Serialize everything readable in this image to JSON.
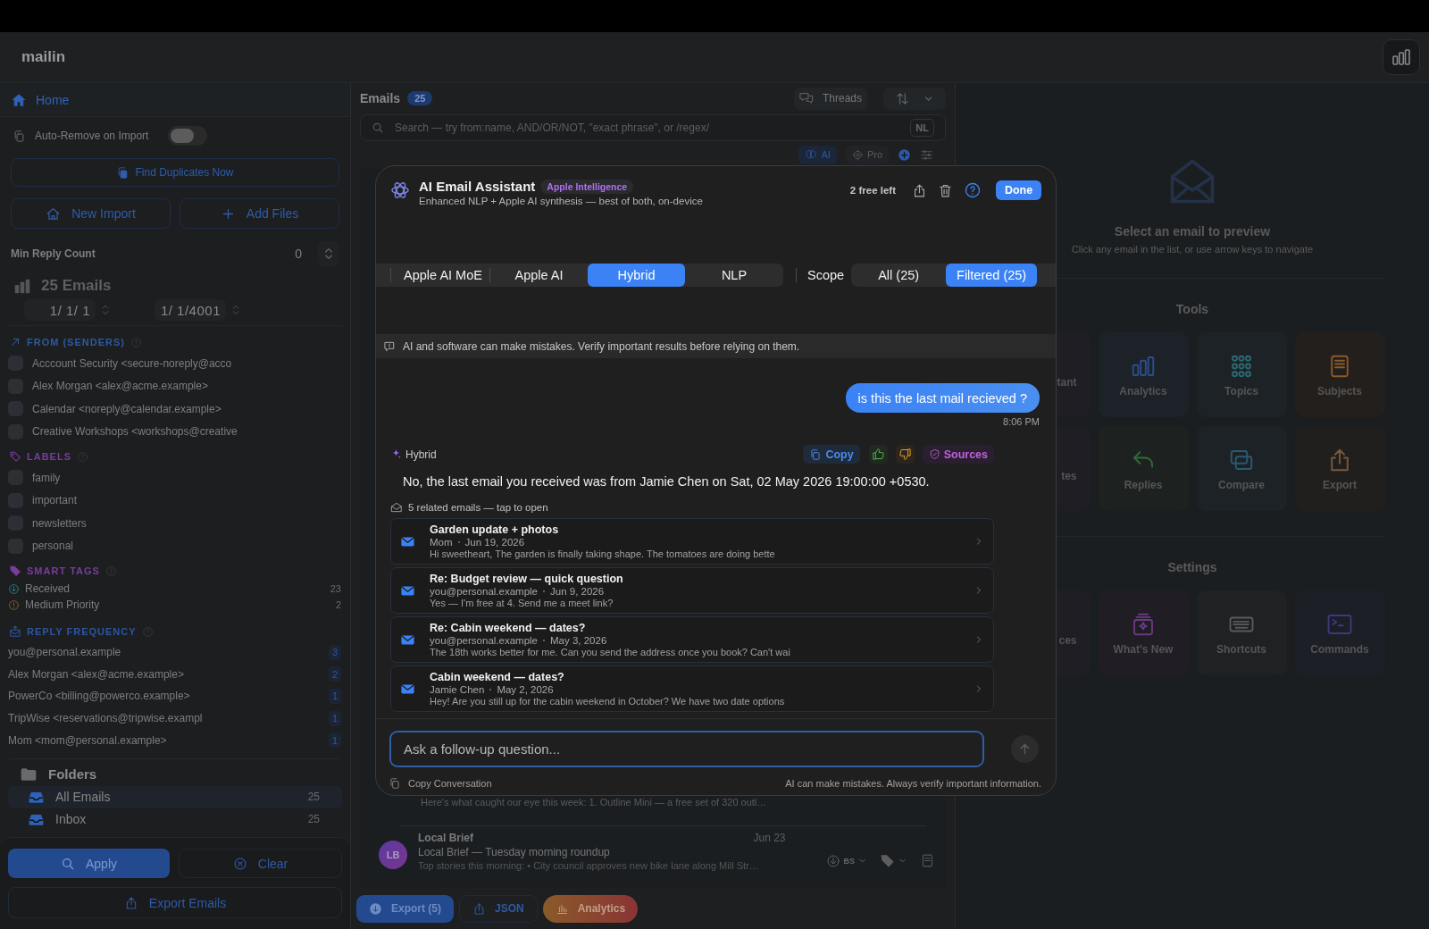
{
  "app": {
    "title": "mailin"
  },
  "sidebar": {
    "home": "Home",
    "auto_remove": {
      "label": "Auto-Remove on Import",
      "on": false
    },
    "find_duplicates": "Find Duplicates Now",
    "import_buttons": [
      {
        "kind": "import",
        "label": "New Import"
      },
      {
        "kind": "add",
        "label": "Add Files"
      }
    ],
    "min_reply": {
      "label": "Min Reply Count",
      "value": "0"
    },
    "email_count": "25 Emails",
    "date_range": [
      "1/ 1/ 1",
      "1/ 1/4001"
    ],
    "senders": {
      "title": "FROM (SENDERS)",
      "items": [
        {
          "label": "Acccount Security <secure-noreply@acco",
          "checked": false
        },
        {
          "label": "Alex Morgan <alex@acme.example>",
          "checked": false
        },
        {
          "label": "Calendar <noreply@calendar.example>",
          "checked": false
        },
        {
          "label": "Creative Workshops <workshops@creative",
          "checked": false
        }
      ]
    },
    "labels": {
      "title": "LABELS",
      "items": [
        {
          "label": "family",
          "checked": false
        },
        {
          "label": "important",
          "checked": false
        },
        {
          "label": "newsletters",
          "checked": false
        },
        {
          "label": "personal",
          "checked": false
        }
      ]
    },
    "smart_tags": {
      "title": "SMART TAGS",
      "items": [
        {
          "kind": "received",
          "label": "Received",
          "count": "23"
        },
        {
          "kind": "priority",
          "label": "Medium Priority",
          "count": "2"
        }
      ]
    },
    "reply_frequency": {
      "title": "REPLY FREQUENCY",
      "items": [
        {
          "label": "you@personal.example",
          "count": "3"
        },
        {
          "label": "Alex Morgan <alex@acme.example>",
          "count": "2"
        },
        {
          "label": "PowerCo <billing@powerco.example>",
          "count": "1"
        },
        {
          "label": "TripWise <reservations@tripwise.exampl",
          "count": "1"
        },
        {
          "label": "Mom <mom@personal.example>",
          "count": "1"
        }
      ]
    },
    "folders": {
      "title": "Folders",
      "items": [
        {
          "label": "All Emails",
          "count": "25",
          "selected": true
        },
        {
          "label": "Inbox",
          "count": "25",
          "selected": false
        }
      ]
    },
    "actions": {
      "apply": "Apply",
      "clear": "Clear",
      "export": "Export Emails"
    }
  },
  "email_list": {
    "title": "Emails",
    "count": "25",
    "threads": "Threads",
    "search": {
      "placeholder": "Search — try from:name, AND/OR/NOT, \"exact phrase\", or /regex/",
      "mode": "NL"
    },
    "tools": {
      "ai": "AI",
      "pro": "Pro"
    },
    "snippet": "Here's what caught our eye this week: 1. Outline Mini — a free set of 320 outl…",
    "rows": [
      {
        "initials": "LB",
        "sender": "Local Brief",
        "date": "Jun 23",
        "subject": "Local Brief — Tuesday morning roundup",
        "preview": "Top stories this morning: • City council approves new bike lane along Mill Str…",
        "category": "BS"
      }
    ],
    "bottom_bar": [
      {
        "kind": "export",
        "label": "Export (5)"
      },
      {
        "kind": "json",
        "label": "JSON"
      },
      {
        "kind": "analytics",
        "label": "Analytics"
      }
    ]
  },
  "preview": {
    "title": "Select an email to preview",
    "hint": "Click any email in the list, or use arrow keys to navigate",
    "tools": {
      "title": "Tools",
      "items": [
        {
          "label": "tant"
        },
        {
          "kind": "analytics",
          "label": "Analytics"
        },
        {
          "kind": "topics",
          "label": "Topics"
        },
        {
          "kind": "subjects",
          "label": "Subjects"
        },
        {
          "label": "tes"
        },
        {
          "kind": "replies",
          "label": "Replies"
        },
        {
          "kind": "compare",
          "label": "Compare"
        },
        {
          "kind": "export",
          "label": "Export"
        }
      ]
    },
    "settings": {
      "title": "Settings",
      "items": [
        {
          "label": "ces"
        },
        {
          "kind": "news",
          "label": "What's New"
        },
        {
          "kind": "shortcuts",
          "label": "Shortcuts"
        },
        {
          "kind": "commands",
          "label": "Commands"
        }
      ]
    }
  },
  "assistant": {
    "title": "AI Email Assistant",
    "badge": "Apple Intelligence",
    "subtitle": "Enhanced NLP + Apple AI synthesis — best of both, on-device",
    "quota": "2 free left",
    "done": "Done",
    "modes": [
      {
        "label": "Apple AI MoE",
        "selected": false
      },
      {
        "label": "Apple AI",
        "selected": false
      },
      {
        "label": "Hybrid",
        "selected": true
      },
      {
        "label": "NLP",
        "selected": false
      }
    ],
    "scope": {
      "label": "Scope",
      "options": [
        {
          "label": "All (25)",
          "selected": false
        },
        {
          "label": "Filtered (25)",
          "selected": true
        }
      ]
    },
    "disclaimer": "AI and software can make mistakes. Verify important results before relying on them.",
    "messages": [
      {
        "kind": "user",
        "text": "is this the last mail recieved ?",
        "time": "8:06 PM"
      },
      {
        "kind": "assistant",
        "source": "Hybrid",
        "copy": "Copy",
        "sources": "Sources",
        "text": "No, the last email you received was from Jamie Chen on Sat, 02 May 2026 19:00:00 +0530.",
        "related": {
          "title": "5 related emails — tap to open",
          "items": [
            {
              "subject": "Garden update + photos",
              "sender": "Mom",
              "date": "Jun 19, 2026",
              "preview": "Hi sweetheart, The garden is finally taking shape. The tomatoes are doing bette"
            },
            {
              "subject": "Re: Budget review — quick question",
              "sender": "you@personal.example",
              "date": "Jun 9, 2026",
              "preview": "Yes — I'm free at 4. Send me a meet link?"
            },
            {
              "subject": "Re: Cabin weekend — dates?",
              "sender": "you@personal.example",
              "date": "May 3, 2026",
              "preview": "The 18th works better for me. Can you send the address once you book? Can't wai"
            },
            {
              "subject": "Cabin weekend — dates?",
              "sender": "Jamie Chen",
              "date": "May 2, 2026",
              "preview": "Hey! Are you still up for the cabin weekend in October? We have two date options"
            }
          ]
        }
      }
    ],
    "input": {
      "placeholder": "Ask a follow-up question..."
    },
    "footer": {
      "copy": "Copy Conversation",
      "note": "AI can make mistakes. Always verify important information."
    }
  }
}
